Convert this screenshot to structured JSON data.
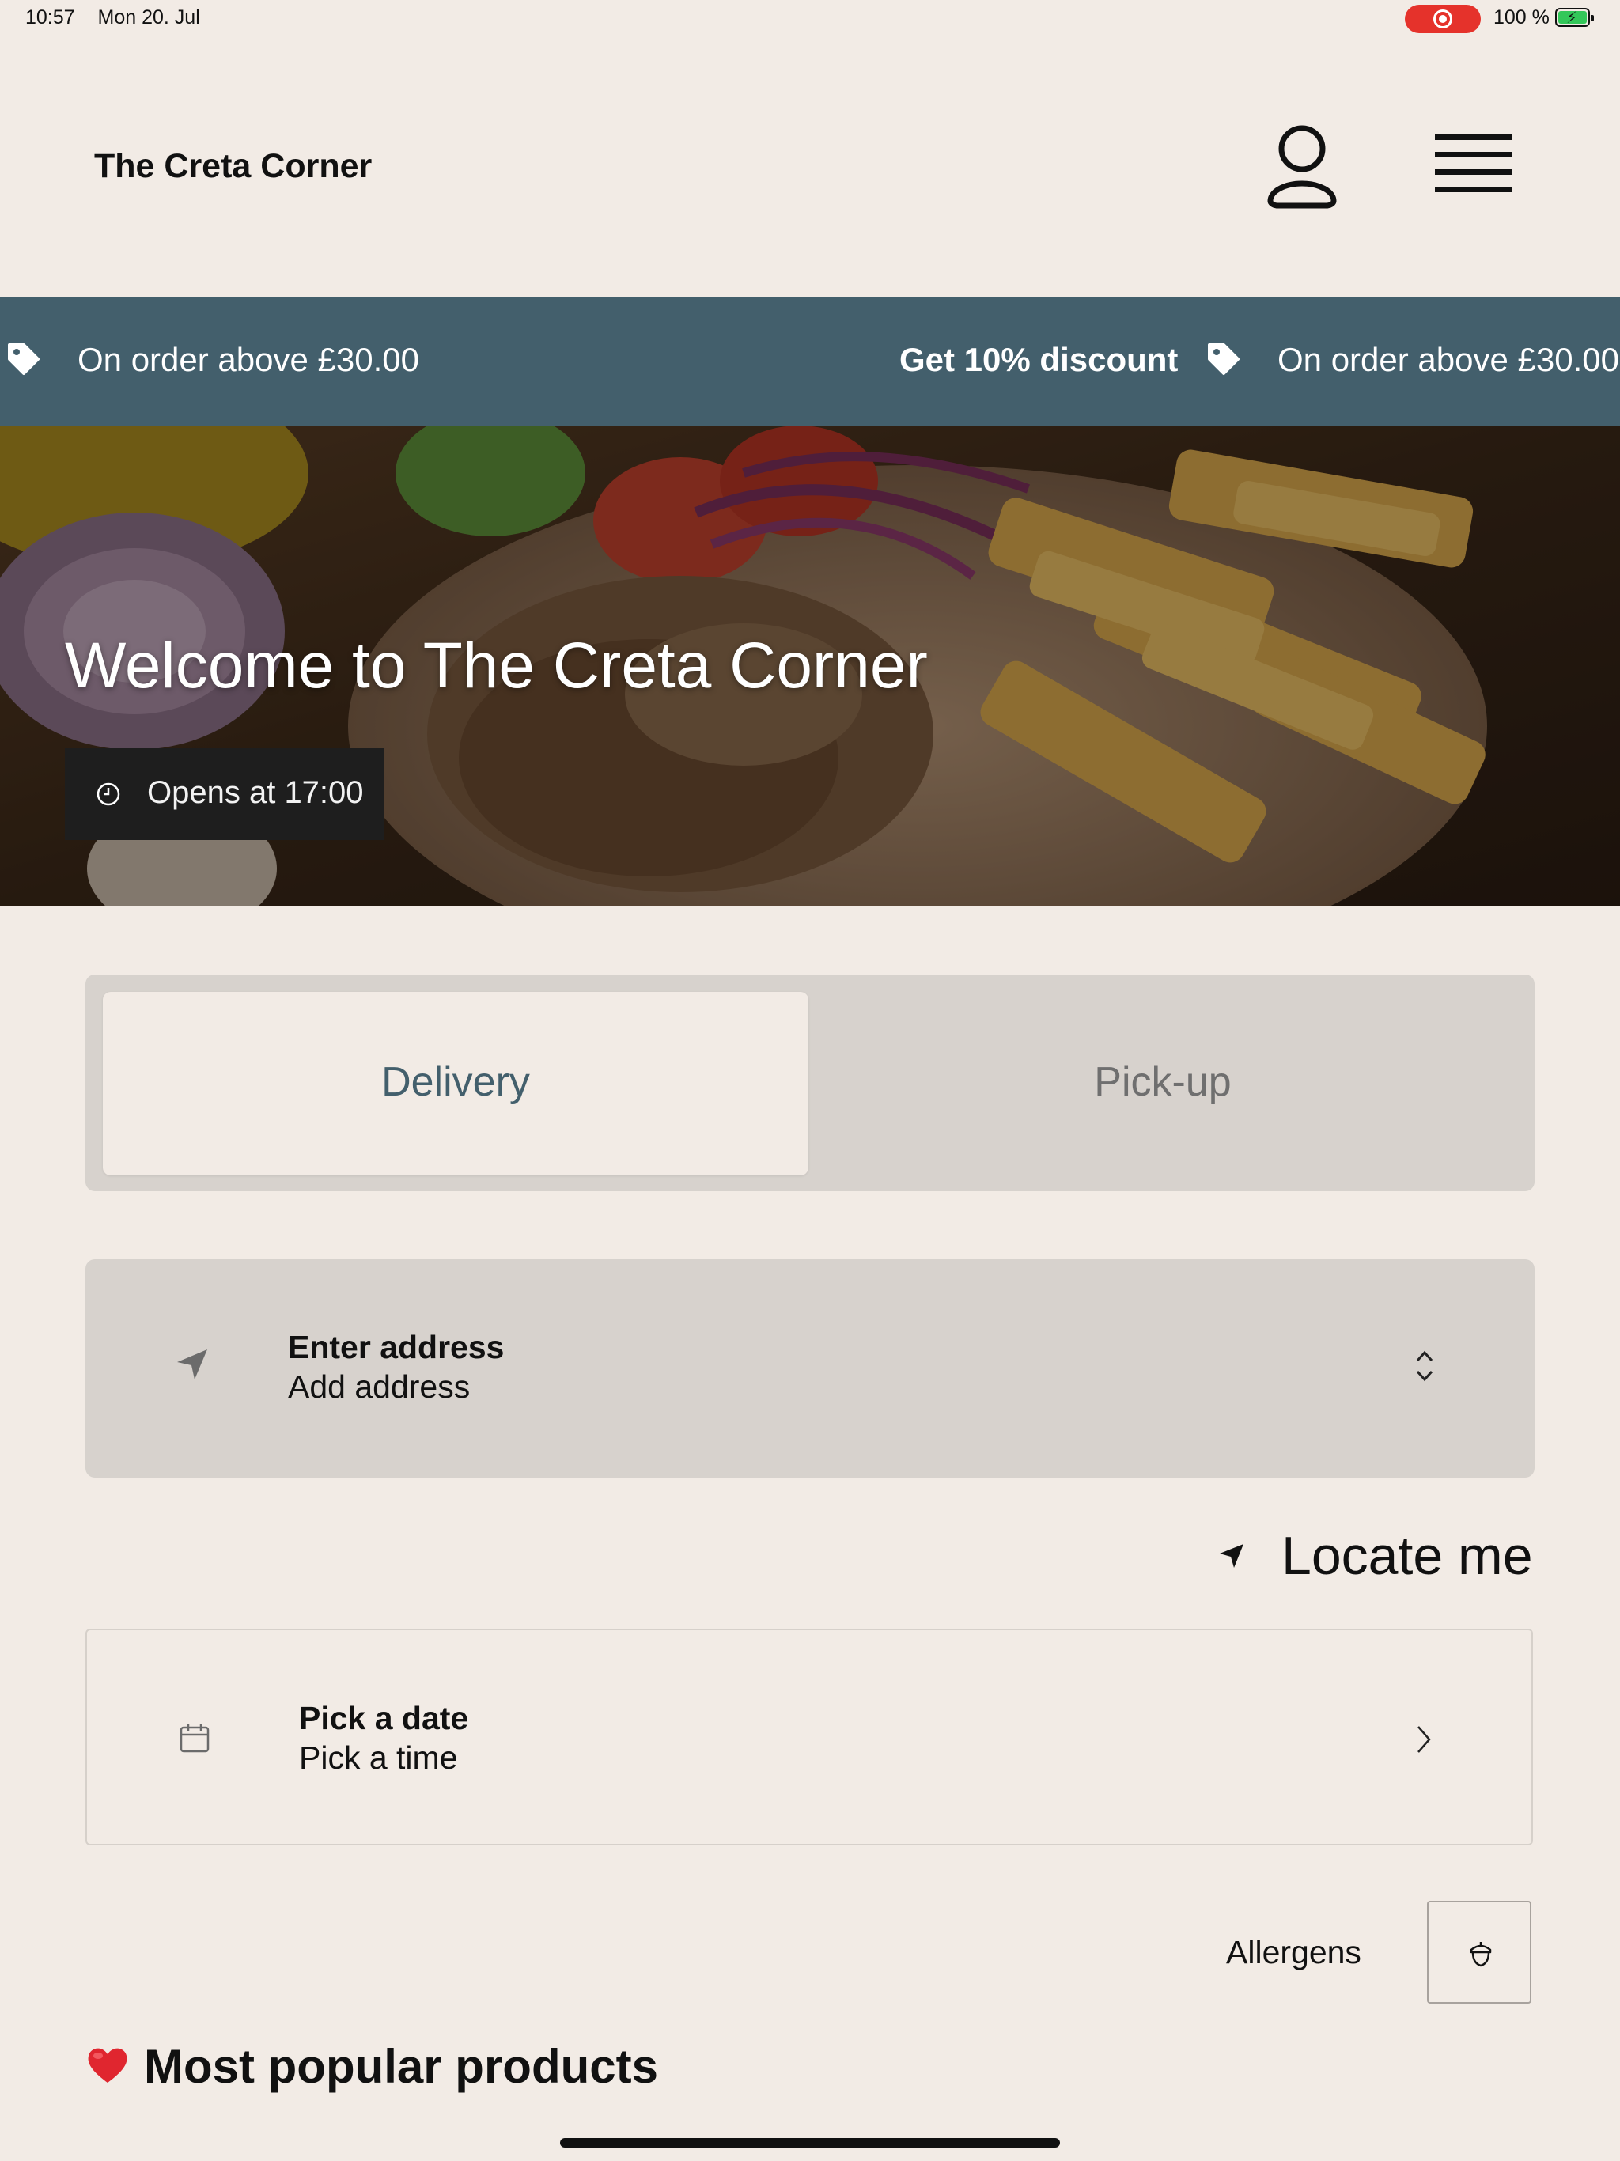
{
  "status_bar": {
    "time": "10:57",
    "date": "Mon 20. Jul",
    "battery": "100 %"
  },
  "header": {
    "brand": "The Creta Corner"
  },
  "promo": {
    "offer_left": "On order above £30.00",
    "discount": "Get 10% discount",
    "offer_right": "On order above £30.00",
    "color": "#435f6c"
  },
  "hero": {
    "title": "Welcome to The Creta Corner",
    "opens": "Opens at 17:00"
  },
  "order_mode": {
    "options": [
      "Delivery",
      "Pick-up"
    ],
    "selected": "Delivery"
  },
  "address": {
    "title": "Enter address",
    "subtitle": "Add address"
  },
  "locate": {
    "label": "Locate me"
  },
  "schedule": {
    "title": "Pick a date",
    "subtitle": "Pick a time"
  },
  "allergens": {
    "label": "Allergens"
  },
  "popular": {
    "title": "Most popular products",
    "emoji_icon": "heart-icon"
  },
  "colors": {
    "background": "#f2ebe5",
    "accent": "#435f6c",
    "panel": "#d7d2cd"
  }
}
